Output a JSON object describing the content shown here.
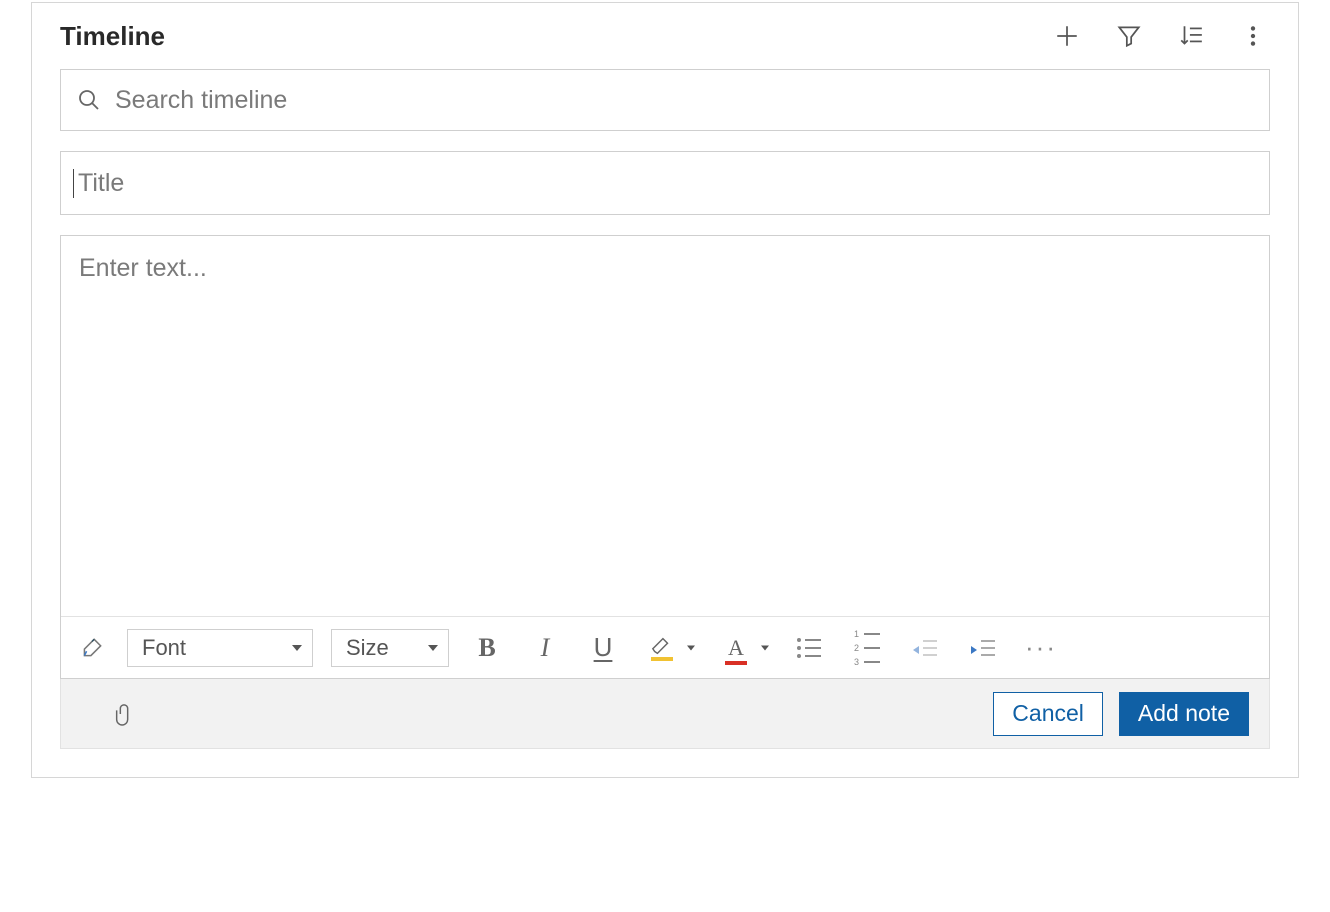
{
  "header": {
    "title": "Timeline"
  },
  "search": {
    "placeholder": "Search timeline",
    "value": ""
  },
  "note": {
    "title_placeholder": "Title",
    "title_value": "",
    "body_placeholder": "Enter text...",
    "body_value": ""
  },
  "toolbar": {
    "font_label": "Font",
    "size_label": "Size",
    "bold_glyph": "B",
    "italic_glyph": "I",
    "underline_glyph": "U",
    "fontcolor_glyph": "A",
    "more_glyph": "···"
  },
  "footer": {
    "cancel_label": "Cancel",
    "add_label": "Add note"
  }
}
